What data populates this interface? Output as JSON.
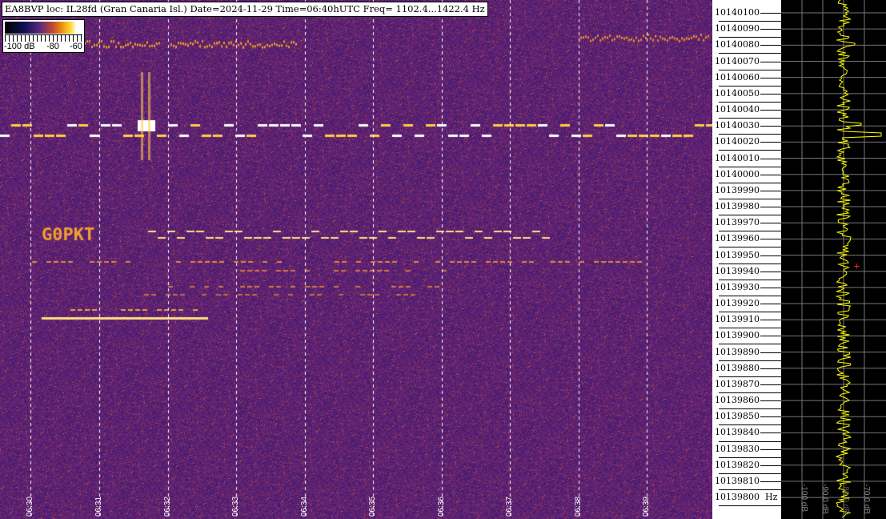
{
  "header": {
    "title": "EA8BVP loc: IL28fd (Gran Canaria Isl.) Date=2024-11-29 Time=06:40hUTC Freq= 1102.4...1422.4 Hz"
  },
  "colorbar": {
    "min_label": "-100 dB",
    "mid_label": "-80",
    "max_label": "-60"
  },
  "time_axis": {
    "labels": [
      "06:30",
      "06:31",
      "06:32",
      "06:33",
      "06:34",
      "06:35",
      "06:36",
      "06:37",
      "06:38",
      "06:39"
    ]
  },
  "freq_axis": {
    "unit": "Hz",
    "labels": [
      "10140100",
      "10140090",
      "10140080",
      "10140070",
      "10140060",
      "10140050",
      "10140040",
      "10140030",
      "10140020",
      "10140010",
      "10140000",
      "10139990",
      "10139980",
      "10139970",
      "10139960",
      "10139950",
      "10139940",
      "10139930",
      "10139920",
      "10139910",
      "10139900",
      "10139890",
      "10139880",
      "10139870",
      "10139860",
      "10139850",
      "10139840",
      "10139830",
      "10139820",
      "10139810",
      "10139800"
    ]
  },
  "level_panel": {
    "labels": [
      "-100 dB",
      "-90.0 dB",
      "-80.0 dB",
      "-70.0 dB"
    ],
    "trace_color": "#ffff00",
    "marker_color": "#ff2020"
  }
}
